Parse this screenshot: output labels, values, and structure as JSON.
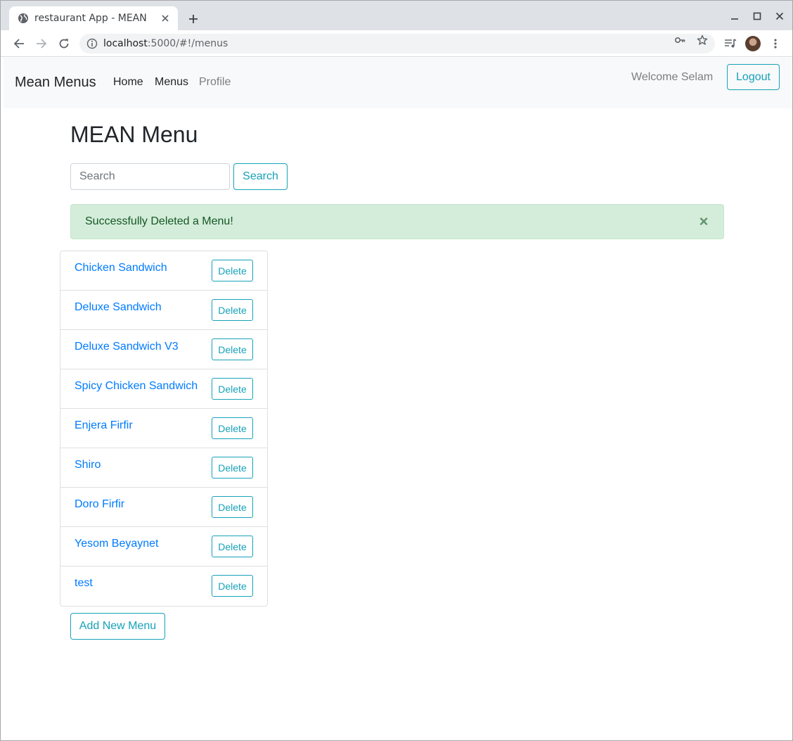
{
  "browser": {
    "tab_title": "restaurant App - MEAN",
    "url_host": "localhost",
    "url_rest": ":5000/#!/menus"
  },
  "navbar": {
    "brand": "Mean Menus",
    "links": [
      {
        "label": "Home"
      },
      {
        "label": "Menus"
      },
      {
        "label": "Profile"
      }
    ],
    "welcome": "Welcome Selam",
    "logout_label": "Logout"
  },
  "main": {
    "title": "MEAN Menu",
    "search": {
      "placeholder": "Search",
      "value": "",
      "button_label": "Search"
    },
    "alert": {
      "message": "Successfully Deleted a Menu!",
      "close": "×"
    },
    "menus": [
      {
        "name": "Chicken Sandwich",
        "action": "Delete"
      },
      {
        "name": "Deluxe Sandwich",
        "action": "Delete"
      },
      {
        "name": "Deluxe Sandwich V3",
        "action": "Delete"
      },
      {
        "name": "Spicy Chicken Sandwich",
        "action": "Delete"
      },
      {
        "name": "Enjera Firfir",
        "action": "Delete"
      },
      {
        "name": "Shiro",
        "action": "Delete"
      },
      {
        "name": "Doro Firfir",
        "action": "Delete"
      },
      {
        "name": "Yesom Beyaynet",
        "action": "Delete"
      },
      {
        "name": "test",
        "action": "Delete"
      }
    ],
    "add_label": "Add New Menu"
  },
  "colors": {
    "accent": "#17a2b8",
    "link": "#007bff",
    "alert_bg": "#d4edda",
    "alert_text": "#155724",
    "navbar_bg": "#f8f9fa"
  }
}
